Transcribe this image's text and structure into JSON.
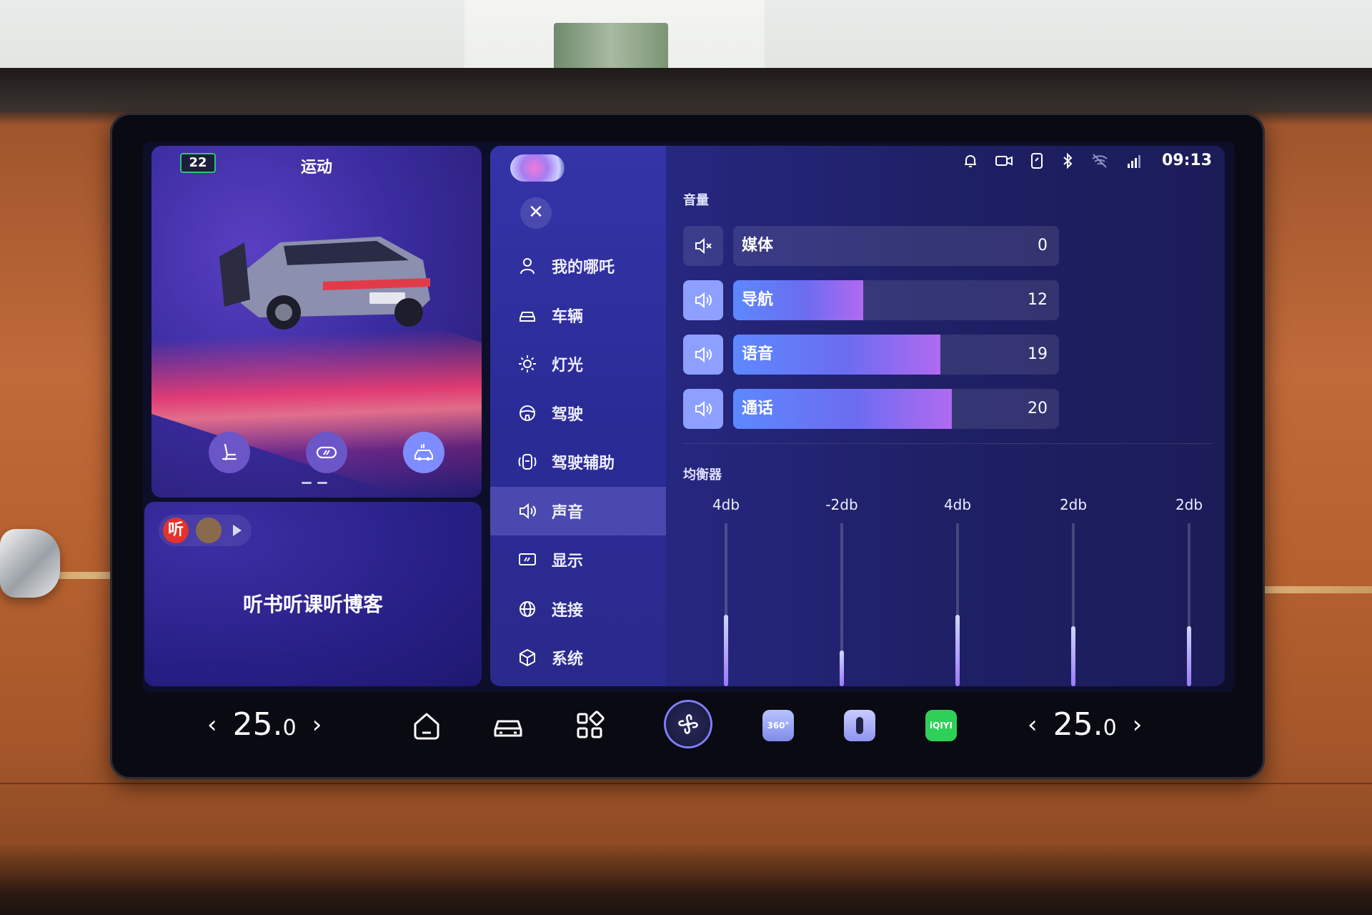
{
  "left_panel": {
    "battery_level": "22",
    "drive_mode": "运动",
    "car_action_icons": [
      "seat-icon",
      "mirror-icon",
      "car-parking-icon"
    ],
    "media": {
      "app_icons": [
        "ting-app-icon",
        "music-app-icon"
      ],
      "app_badge": "听",
      "title": "听书听课听博客"
    }
  },
  "status_bar": {
    "icons": [
      "bell-icon",
      "camera-icon",
      "phone-icon",
      "bluetooth-icon",
      "wifi-off-icon",
      "signal-4g-icon"
    ],
    "time": "09:13"
  },
  "settings": {
    "nav_items": [
      {
        "label": "我的哪吒",
        "icon": "user-icon"
      },
      {
        "label": "车辆",
        "icon": "car-icon"
      },
      {
        "label": "灯光",
        "icon": "sun-icon"
      },
      {
        "label": "驾驶",
        "icon": "steering-icon"
      },
      {
        "label": "驾驶辅助",
        "icon": "assist-icon"
      },
      {
        "label": "声音",
        "icon": "speaker-icon",
        "active": true
      },
      {
        "label": "显示",
        "icon": "display-icon"
      },
      {
        "label": "连接",
        "icon": "globe-icon"
      },
      {
        "label": "系统",
        "icon": "cube-icon"
      }
    ],
    "volume_title": "音量",
    "volume": [
      {
        "name": "媒体",
        "value": "0",
        "level": 0,
        "muted": true
      },
      {
        "name": "导航",
        "value": "12",
        "level": 0.4
      },
      {
        "name": "语音",
        "value": "19",
        "level": 0.635
      },
      {
        "name": "通话",
        "value": "20",
        "level": 0.67
      }
    ],
    "equalizer_title": "均衡器",
    "equalizer": [
      {
        "label": "4db",
        "level": 0.44
      },
      {
        "label": "-2db",
        "level": 0.22
      },
      {
        "label": "4db",
        "level": 0.44
      },
      {
        "label": "2db",
        "level": 0.37
      },
      {
        "label": "2db",
        "level": 0.37
      }
    ]
  },
  "dock": {
    "left_temp_value": "25.",
    "left_temp_decimal": "0",
    "right_temp_value": "25.",
    "right_temp_decimal": "0",
    "icons": [
      "home-icon",
      "car-icon",
      "apps-grid-icon",
      "fan-icon",
      "camera-360-icon",
      "seat-heat-icon",
      "iqiyi-icon"
    ],
    "app_360_label": "360°",
    "app_iqiyi_label": "iQIYI"
  }
}
